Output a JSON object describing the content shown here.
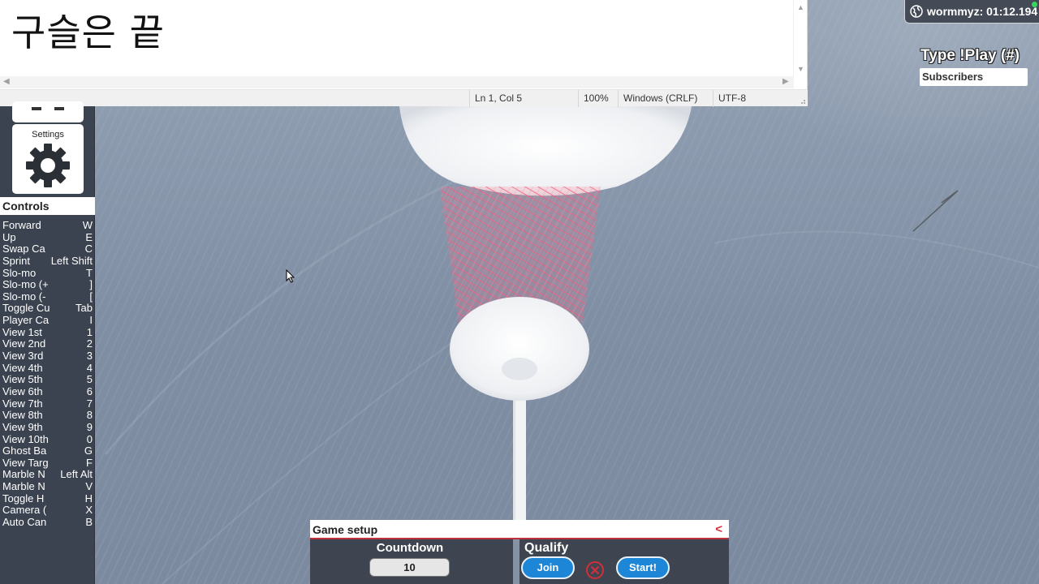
{
  "notepad": {
    "content": "구슬은 끝",
    "status": {
      "position": "Ln 1, Col 5",
      "zoom": "100%",
      "line_ending": "Windows (CRLF)",
      "encoding": "UTF-8"
    },
    "scroll_up_glyph": "▲",
    "scroll_down_glyph": "▼",
    "scroll_left_glyph": "◀",
    "scroll_right_glyph": "▶"
  },
  "left_panel": {
    "settings_label": "Settings",
    "controls_title": "Controls",
    "controls": [
      {
        "name": "Forward",
        "key": "W"
      },
      {
        "name": "Up",
        "key": "E"
      },
      {
        "name": "Swap Ca",
        "key": "C"
      },
      {
        "name": "Sprint",
        "key": "Left Shift"
      },
      {
        "name": "Slo-mo",
        "key": "T"
      },
      {
        "name": "Slo-mo (+",
        "key": "]"
      },
      {
        "name": "Slo-mo (-",
        "key": "["
      },
      {
        "name": "Toggle Cu",
        "key": "Tab"
      },
      {
        "name": "Player Ca",
        "key": "I"
      },
      {
        "name": "View 1st",
        "key": "1"
      },
      {
        "name": "View 2nd",
        "key": "2"
      },
      {
        "name": "View 3rd",
        "key": "3"
      },
      {
        "name": "View 4th",
        "key": "4"
      },
      {
        "name": "View 5th",
        "key": "5"
      },
      {
        "name": "View 6th",
        "key": "6"
      },
      {
        "name": "View 7th",
        "key": "7"
      },
      {
        "name": "View 8th",
        "key": "8"
      },
      {
        "name": "View 9th",
        "key": "9"
      },
      {
        "name": "View 10th",
        "key": "0"
      },
      {
        "name": "Ghost Ba",
        "key": "G"
      },
      {
        "name": "View Targ",
        "key": "F"
      },
      {
        "name": "Marble N",
        "key": "Left Alt"
      },
      {
        "name": "Marble N",
        "key": "V"
      },
      {
        "name": "Toggle H",
        "key": "H"
      },
      {
        "name": "Camera (",
        "key": "X"
      },
      {
        "name": "Auto Can",
        "key": "B"
      }
    ]
  },
  "overlay": {
    "user_badge": "wormmyz: 01:12.194",
    "type_play": "Type !Play (#)",
    "subscribers_label": "Subscribers",
    "online_color": "#38d45b"
  },
  "game_setup": {
    "title": "Game setup",
    "collapse_glyph": "<",
    "countdown_label": "Countdown",
    "countdown_value": "10",
    "qualify_label": "Qualify",
    "join_label": "Join",
    "start_label": "Start!",
    "accent_color": "#c0303a",
    "button_color": "#1e86d6"
  }
}
